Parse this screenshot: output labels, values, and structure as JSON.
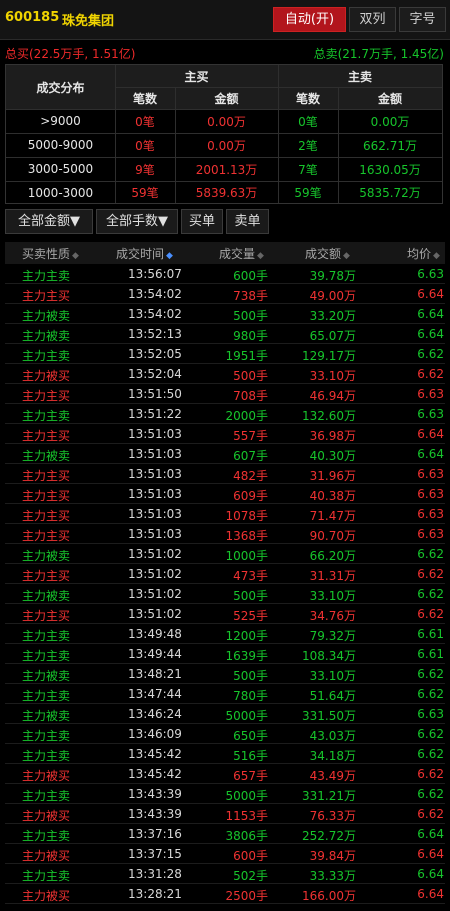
{
  "header": {
    "code": "600185",
    "name": "珠免集团",
    "tabs": [
      "自动(开)",
      "双列",
      "字号"
    ]
  },
  "totals": {
    "buy": "总买(22.5万手, 1.51亿)",
    "sell": "总卖(21.7万手, 1.45亿)"
  },
  "distribution": {
    "corner": "成交分布",
    "buy_title": "主买",
    "sell_title": "主卖",
    "sub": [
      "笔数",
      "金额",
      "笔数",
      "金额"
    ],
    "rows": [
      {
        "range": ">9000",
        "buy_count": "0笔",
        "buy_amount": "0.00万",
        "sell_count": "0笔",
        "sell_amount": "0.00万"
      },
      {
        "range": "5000-9000",
        "buy_count": "0笔",
        "buy_amount": "0.00万",
        "sell_count": "2笔",
        "sell_amount": "662.71万"
      },
      {
        "range": "3000-5000",
        "buy_count": "9笔",
        "buy_amount": "2001.13万",
        "sell_count": "7笔",
        "sell_amount": "1630.05万"
      },
      {
        "range": "1000-3000",
        "buy_count": "59笔",
        "buy_amount": "5839.63万",
        "sell_count": "59笔",
        "sell_amount": "5835.72万"
      }
    ]
  },
  "filters": [
    "全部金额▼",
    "全部手数▼",
    "买单",
    "卖单"
  ],
  "columns": [
    "买卖性质",
    "成交时间",
    "成交量",
    "成交额",
    "均价"
  ],
  "colors": {
    "red": "#f03232",
    "green": "#17c52c",
    "accent": "#b2151c",
    "code": "#f0d400"
  },
  "trades": [
    {
      "type": "主力主卖",
      "time": "13:56:07",
      "vol": "600手",
      "amt": "39.78万",
      "avg": "6.63",
      "side": "sell"
    },
    {
      "type": "主力主买",
      "time": "13:54:02",
      "vol": "738手",
      "amt": "49.00万",
      "avg": "6.64",
      "side": "buy"
    },
    {
      "type": "主力被卖",
      "time": "13:54:02",
      "vol": "500手",
      "amt": "33.20万",
      "avg": "6.64",
      "side": "sell"
    },
    {
      "type": "主力被卖",
      "time": "13:52:13",
      "vol": "980手",
      "amt": "65.07万",
      "avg": "6.64",
      "side": "sell"
    },
    {
      "type": "主力主卖",
      "time": "13:52:05",
      "vol": "1951手",
      "amt": "129.17万",
      "avg": "6.62",
      "side": "sell"
    },
    {
      "type": "主力被买",
      "time": "13:52:04",
      "vol": "500手",
      "amt": "33.10万",
      "avg": "6.62",
      "side": "buy"
    },
    {
      "type": "主力主买",
      "time": "13:51:50",
      "vol": "708手",
      "amt": "46.94万",
      "avg": "6.63",
      "side": "buy"
    },
    {
      "type": "主力主卖",
      "time": "13:51:22",
      "vol": "2000手",
      "amt": "132.60万",
      "avg": "6.63",
      "side": "sell"
    },
    {
      "type": "主力主买",
      "time": "13:51:03",
      "vol": "557手",
      "amt": "36.98万",
      "avg": "6.64",
      "side": "buy"
    },
    {
      "type": "主力被卖",
      "time": "13:51:03",
      "vol": "607手",
      "amt": "40.30万",
      "avg": "6.64",
      "side": "sell"
    },
    {
      "type": "主力主买",
      "time": "13:51:03",
      "vol": "482手",
      "amt": "31.96万",
      "avg": "6.63",
      "side": "buy"
    },
    {
      "type": "主力主买",
      "time": "13:51:03",
      "vol": "609手",
      "amt": "40.38万",
      "avg": "6.63",
      "side": "buy"
    },
    {
      "type": "主力主买",
      "time": "13:51:03",
      "vol": "1078手",
      "amt": "71.47万",
      "avg": "6.63",
      "side": "buy"
    },
    {
      "type": "主力主买",
      "time": "13:51:03",
      "vol": "1368手",
      "amt": "90.70万",
      "avg": "6.63",
      "side": "buy"
    },
    {
      "type": "主力被卖",
      "time": "13:51:02",
      "vol": "1000手",
      "amt": "66.20万",
      "avg": "6.62",
      "side": "sell"
    },
    {
      "type": "主力主买",
      "time": "13:51:02",
      "vol": "473手",
      "amt": "31.31万",
      "avg": "6.62",
      "side": "buy"
    },
    {
      "type": "主力被卖",
      "time": "13:51:02",
      "vol": "500手",
      "amt": "33.10万",
      "avg": "6.62",
      "side": "sell"
    },
    {
      "type": "主力主买",
      "time": "13:51:02",
      "vol": "525手",
      "amt": "34.76万",
      "avg": "6.62",
      "side": "buy"
    },
    {
      "type": "主力主卖",
      "time": "13:49:48",
      "vol": "1200手",
      "amt": "79.32万",
      "avg": "6.61",
      "side": "sell"
    },
    {
      "type": "主力主卖",
      "time": "13:49:44",
      "vol": "1639手",
      "amt": "108.34万",
      "avg": "6.61",
      "side": "sell"
    },
    {
      "type": "主力被卖",
      "time": "13:48:21",
      "vol": "500手",
      "amt": "33.10万",
      "avg": "6.62",
      "side": "sell"
    },
    {
      "type": "主力主卖",
      "time": "13:47:44",
      "vol": "780手",
      "amt": "51.64万",
      "avg": "6.62",
      "side": "sell"
    },
    {
      "type": "主力被卖",
      "time": "13:46:24",
      "vol": "5000手",
      "amt": "331.50万",
      "avg": "6.63",
      "side": "sell"
    },
    {
      "type": "主力主卖",
      "time": "13:46:09",
      "vol": "650手",
      "amt": "43.03万",
      "avg": "6.62",
      "side": "sell"
    },
    {
      "type": "主力主卖",
      "time": "13:45:42",
      "vol": "516手",
      "amt": "34.18万",
      "avg": "6.62",
      "side": "sell"
    },
    {
      "type": "主力被买",
      "time": "13:45:42",
      "vol": "657手",
      "amt": "43.49万",
      "avg": "6.62",
      "side": "buy"
    },
    {
      "type": "主力主卖",
      "time": "13:43:39",
      "vol": "5000手",
      "amt": "331.21万",
      "avg": "6.62",
      "side": "sell"
    },
    {
      "type": "主力被买",
      "time": "13:43:39",
      "vol": "1153手",
      "amt": "76.33万",
      "avg": "6.62",
      "side": "buy"
    },
    {
      "type": "主力主卖",
      "time": "13:37:16",
      "vol": "3806手",
      "amt": "252.72万",
      "avg": "6.64",
      "side": "sell"
    },
    {
      "type": "主力被买",
      "time": "13:37:15",
      "vol": "600手",
      "amt": "39.84万",
      "avg": "6.64",
      "side": "buy"
    },
    {
      "type": "主力主卖",
      "time": "13:31:28",
      "vol": "502手",
      "amt": "33.33万",
      "avg": "6.64",
      "side": "sell"
    },
    {
      "type": "主力被买",
      "time": "13:28:21",
      "vol": "2500手",
      "amt": "166.00万",
      "avg": "6.64",
      "side": "buy"
    }
  ]
}
